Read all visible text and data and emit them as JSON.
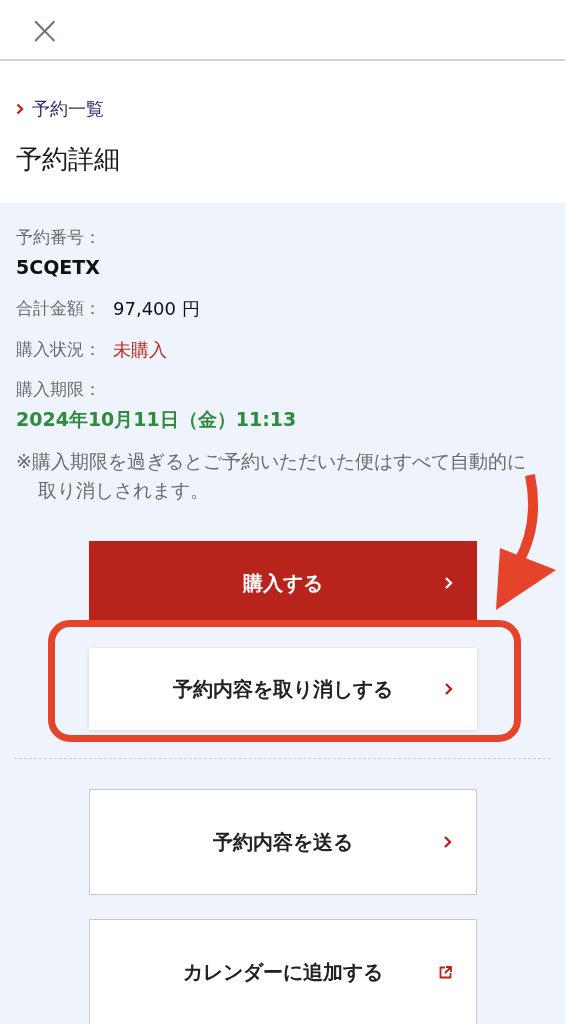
{
  "header": {
    "close": "×"
  },
  "breadcrumb": {
    "label": "予約一覧"
  },
  "title": "予約詳細",
  "fields": [
    {
      "label": "予約番号：",
      "value": "5CQETX",
      "kind": "code"
    },
    {
      "label": "合計金額：",
      "value": "97,400 円",
      "kind": "amount"
    },
    {
      "label": "購入状況：",
      "value": "未購入",
      "kind": "status"
    },
    {
      "label": "購入期限：",
      "value": "2024年10月11日（金）11:13",
      "kind": "deadline"
    }
  ],
  "note": "※購入期限を過ぎるとご予約いただいた便はすべて自動的に取り消しされます。",
  "buttons": [
    {
      "label": "購入する",
      "kind": "primary"
    },
    {
      "label": "予約内容を取り消しする",
      "kind": "raised"
    },
    {
      "label": "予約内容を送る",
      "kind": "outlined"
    },
    {
      "label": "カレンダーに追加する",
      "kind": "external"
    }
  ]
}
